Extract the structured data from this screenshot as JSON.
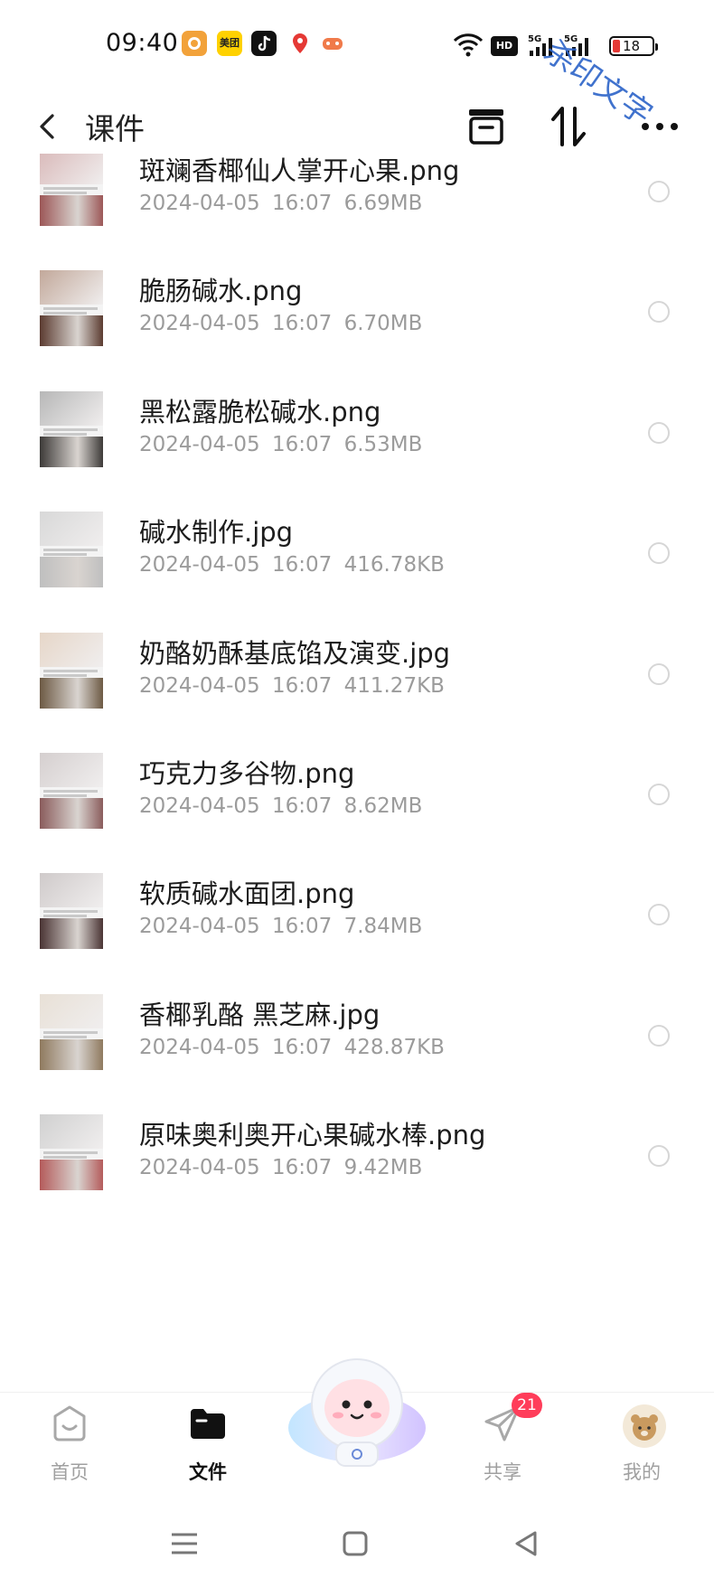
{
  "status_bar": {
    "time": "09:40",
    "app_icons": [
      "orange-app-icon",
      "meituan-icon",
      "douyin-icon",
      "map-pin-icon",
      "game-icon"
    ],
    "app_meituan_label": "美团",
    "hd_label": "HD",
    "signal_label_1": "5G",
    "signal_label_2": "5G",
    "battery": "18",
    "battery_color": "#e53935"
  },
  "watermark": "杀印文字",
  "header": {
    "title": "课件",
    "icons": [
      "back-arrow-icon",
      "archive-icon",
      "sort-icon",
      "more-icon"
    ]
  },
  "files": [
    {
      "name": "斑斓香椰仙人掌开心果.png",
      "date": "2024-04-05",
      "time": "16:07",
      "size": "6.69MB"
    },
    {
      "name": "脆肠碱水.png",
      "date": "2024-04-05",
      "time": "16:07",
      "size": "6.70MB"
    },
    {
      "name": "黑松露脆松碱水.png",
      "date": "2024-04-05",
      "time": "16:07",
      "size": "6.53MB"
    },
    {
      "name": "碱水制作.jpg",
      "date": "2024-04-05",
      "time": "16:07",
      "size": "416.78KB"
    },
    {
      "name": "奶酪奶酥基底馅及演变.jpg",
      "date": "2024-04-05",
      "time": "16:07",
      "size": "411.27KB"
    },
    {
      "name": "巧克力多谷物.png",
      "date": "2024-04-05",
      "time": "16:07",
      "size": "8.62MB"
    },
    {
      "name": "软质碱水面团.png",
      "date": "2024-04-05",
      "time": "16:07",
      "size": "7.84MB"
    },
    {
      "name": "香椰乳酪 黑芝麻.jpg",
      "date": "2024-04-05",
      "time": "16:07",
      "size": "428.87KB"
    },
    {
      "name": "原味奥利奥开心果碱水棒.png",
      "date": "2024-04-05",
      "time": "16:07",
      "size": "9.42MB"
    }
  ],
  "tabbar": {
    "tabs": [
      {
        "label": "首页",
        "icon": "home-face-icon",
        "active": false
      },
      {
        "label": "文件",
        "icon": "folder-icon",
        "active": true
      },
      {
        "label": "共享",
        "icon": "paper-plane-icon",
        "active": false,
        "badge": "21"
      },
      {
        "label": "我的",
        "icon": "avatar-icon",
        "active": false
      }
    ],
    "center": "astronaut-mascot-icon"
  },
  "system_nav": [
    "menu-icon",
    "home-square-icon",
    "back-triangle-icon"
  ],
  "colors": {
    "accent": "#111111",
    "badge": "#ff3d5a",
    "meta_text": "#9b9b9b",
    "watermark": "#2c63c8"
  }
}
